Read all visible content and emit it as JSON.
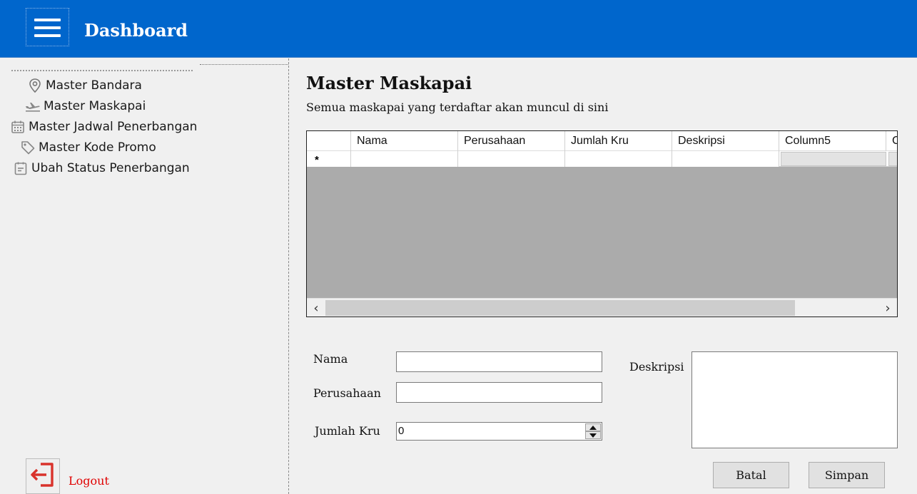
{
  "header": {
    "title": "Dashboard",
    "menu_icon": "hamburger-icon",
    "background": "#0066cc"
  },
  "sidebar": {
    "items": [
      {
        "label": "Master Bandara",
        "icon": "map-pin-icon"
      },
      {
        "label": "Master Maskapai",
        "icon": "airplane-icon"
      },
      {
        "label": "Master Jadwal Penerbangan",
        "icon": "calendar-icon"
      },
      {
        "label": "Master Kode Promo",
        "icon": "tag-icon"
      },
      {
        "label": "Ubah Status Penerbangan",
        "icon": "clipboard-icon"
      }
    ],
    "logout_label": "Logout",
    "logout_icon": "logout-icon",
    "logout_color": "#e00000"
  },
  "main": {
    "title": "Master Maskapai",
    "subtitle": "Semua maskapai yang terdaftar akan muncul di sini"
  },
  "grid": {
    "columns": [
      "Nama",
      "Perusahaan",
      "Jumlah Kru",
      "Deskripsi",
      "Column5",
      "C"
    ],
    "new_row_marker": "*",
    "background": "#ababab"
  },
  "form": {
    "nama_label": "Nama",
    "nama_value": "",
    "perusahaan_label": "Perusahaan",
    "perusahaan_value": "",
    "jumlah_kru_label": "Jumlah Kru",
    "jumlah_kru_value": "0",
    "deskripsi_label": "Deskripsi",
    "deskripsi_value": "",
    "batal_label": "Batal",
    "simpan_label": "Simpan"
  }
}
